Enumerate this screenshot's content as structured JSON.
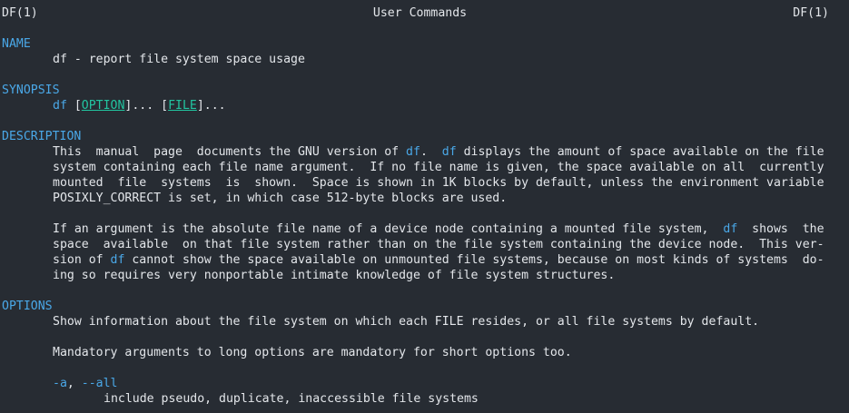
{
  "header": {
    "left": "DF(1)",
    "center": "User Commands",
    "right": "DF(1)"
  },
  "sections": {
    "name": "NAME",
    "synopsis": "SYNOPSIS",
    "description": "DESCRIPTION",
    "options": "OPTIONS"
  },
  "name_line": "df - report file system space usage",
  "synopsis": {
    "cmd": "df",
    "open1": " [",
    "option": "OPTION",
    "mid": "]... [",
    "file": "FILE",
    "close": "]..."
  },
  "description": {
    "p1": {
      "l1_a": "This  manual  page  documents the GNU version of ",
      "l1_df1": "df",
      "l1_b": ".  ",
      "l1_df2": "df",
      "l1_c": " displays the amount of space available on the file",
      "l2": "system containing each file name argument.  If no file name is given, the space available on all  currently",
      "l3": "mounted  file  systems  is  shown.  Space is shown in 1K blocks by default, unless the environment variable",
      "l4": "POSIXLY_CORRECT is set, in which case 512-byte blocks are used."
    },
    "p2": {
      "l1_a": "If an argument is the absolute file name of a device node containing a mounted file system,  ",
      "l1_df": "df",
      "l1_b": "  shows  the",
      "l2": "space  available  on that file system rather than on the file system containing the device node.  This ver-",
      "l3_a": "sion of ",
      "l3_df": "df",
      "l3_b": " cannot show the space available on unmounted file systems, because on most kinds of systems  do-",
      "l4": "ing so requires very nonportable intimate knowledge of file system structures."
    }
  },
  "options": {
    "intro": "Show information about the file system on which each FILE resides, or all file systems by default.",
    "mandatory": "Mandatory arguments to long options are mandatory for short options too.",
    "all_short": "-a",
    "all_sep": ", ",
    "all_long": "--all",
    "all_desc": "include pseudo, duplicate, inaccessible file systems"
  },
  "colors": {
    "background": "#272c33",
    "text": "#e3e6ea",
    "section": "#4aa8e8",
    "underline_arg": "#22c4a0"
  }
}
